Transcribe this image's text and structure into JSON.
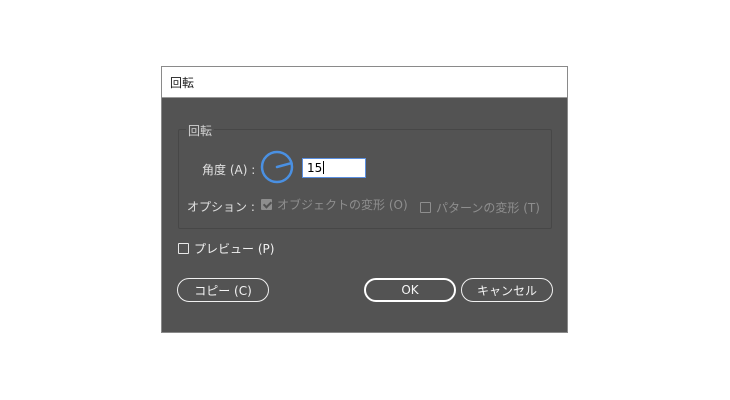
{
  "dialog": {
    "title": "回転",
    "group_title": "回転",
    "angle": {
      "label": "角度 (A) :",
      "value": "15"
    },
    "options": {
      "label": "オプション :",
      "transform_objects": {
        "label": "オブジェクトの変形 (O)",
        "checked": true
      },
      "transform_patterns": {
        "label": "パターンの変形 (T)",
        "checked": false
      }
    },
    "preview": {
      "label": "プレビュー (P)",
      "checked": false
    },
    "buttons": {
      "copy": "コピー (C)",
      "ok": "OK",
      "cancel": "キャンセル"
    }
  },
  "colors": {
    "dialog_bg": "#535353",
    "dial": "#4a90e2",
    "input_border": "#5b8fe0"
  },
  "icons": [
    "rotation-dial-icon",
    "checkbox-icon"
  ]
}
